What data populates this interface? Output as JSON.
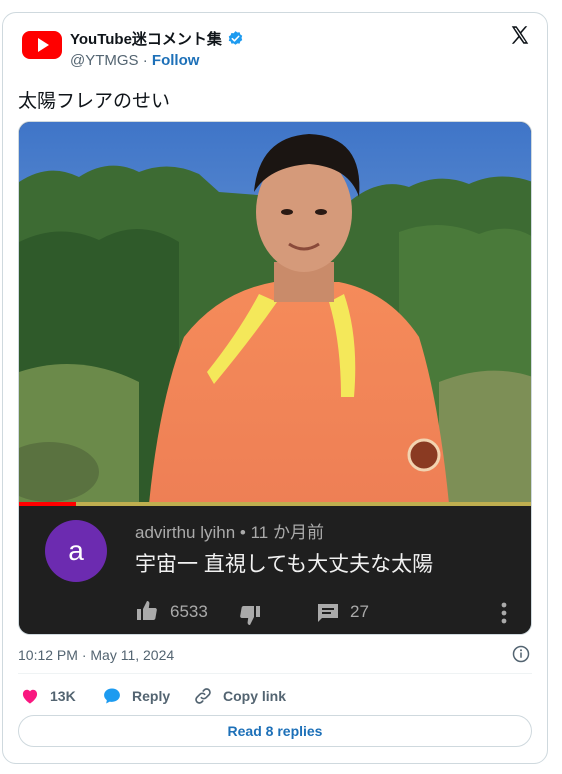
{
  "account": {
    "name": "YouTube迷コメント集",
    "handle": "@YTMGS",
    "separator": "·",
    "follow_label": "Follow"
  },
  "tweet": {
    "text": "太陽フレアのせい",
    "timestamp": "10:12 PM · May 11, 2024"
  },
  "media": {
    "progress_fraction": 0.11,
    "comment": {
      "avatar_letter": "a",
      "author": "advirthu lyihn",
      "meta_separator": "•",
      "age": "11 か月前",
      "body": "宇宙一 直視しても大丈夫な太陽",
      "likes": "6533",
      "replies": "27"
    }
  },
  "actions": {
    "likes": "13K",
    "reply_label": "Reply",
    "copy_label": "Copy link"
  },
  "read_replies_label": "Read 8 replies",
  "colors": {
    "like_pink": "#f91880",
    "reply_blue": "#1d9bf0",
    "link_blue": "#1d70b8",
    "youtube_red": "#ff0000",
    "comment_bg": "#1f1f1f",
    "comment_avatar": "#6c2bb0"
  },
  "icons": [
    "youtube-logo-icon",
    "verified-badge-icon",
    "x-logo-icon",
    "thumbs-up-icon",
    "thumbs-down-icon",
    "comment-reply-icon",
    "more-vertical-icon",
    "info-icon",
    "heart-icon",
    "reply-bubble-icon",
    "link-icon"
  ]
}
